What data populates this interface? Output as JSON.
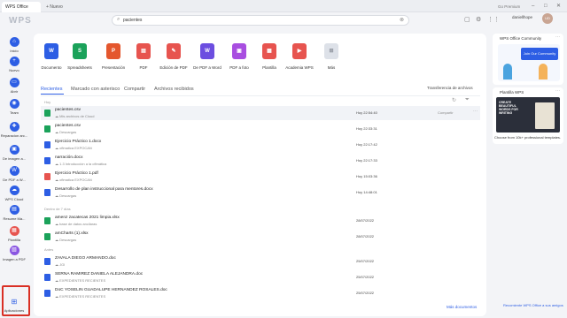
{
  "titlebar": {
    "app_tab": "WPS Office",
    "new_tab": "+  Nuevo",
    "premium": "Go Premium",
    "min": "–",
    "max": "□",
    "close": "✕"
  },
  "search": {
    "value": "pacientes",
    "icon": "search-icon"
  },
  "user": {
    "name": "daniellhope",
    "sub": "",
    "avatar": "UD"
  },
  "sidebar": {
    "items": [
      {
        "label": "Inicio",
        "color": "#2d5ee4",
        "glyph": "⌂"
      },
      {
        "label": "Nuevo",
        "color": "#2d5ee4",
        "glyph": "+"
      },
      {
        "label": "Abrir",
        "color": "#2d5ee4",
        "glyph": "▭"
      },
      {
        "label": "Team",
        "color": "#2d5ee4",
        "glyph": "◉"
      },
      {
        "label": "Reparacion arc...",
        "color": "#2d5ee4",
        "glyph": "✚"
      },
      {
        "label": "De imagen a...",
        "color": "#2d5ee4",
        "glyph": "▣"
      },
      {
        "label": "De PDF a W...",
        "color": "#2d5ee4",
        "glyph": "W"
      },
      {
        "label": "WPS Cloud",
        "color": "#2d5ee4",
        "glyph": "☁"
      },
      {
        "label": "Resume Ma...",
        "color": "#2d5ee4",
        "glyph": "▤"
      },
      {
        "label": "Plantilla",
        "color": "#e7544f",
        "glyph": "▦"
      },
      {
        "label": "Imagen a PDF",
        "color": "#8a56e2",
        "glyph": "▧"
      }
    ],
    "apps": {
      "label": "Aplicaciones",
      "glyph": "⊞"
    }
  },
  "newrow": [
    {
      "label": "Documento",
      "color": "#2d5ee4",
      "glyph": "W"
    },
    {
      "label": "Spreadsheets",
      "color": "#1ba25a",
      "glyph": "S"
    },
    {
      "label": "Presentación",
      "color": "#e4572e",
      "glyph": "P"
    },
    {
      "label": "PDF",
      "color": "#e7544f",
      "glyph": "▤"
    },
    {
      "label": "Edición de PDF",
      "color": "#e7544f",
      "glyph": "✎"
    },
    {
      "label": "De PDF a Word",
      "color": "#6c4ee0",
      "glyph": "W"
    },
    {
      "label": "PDF a foto",
      "color": "#a84ee0",
      "glyph": "▣"
    },
    {
      "label": "Plantilla",
      "color": "#e7544f",
      "glyph": "▦"
    },
    {
      "label": "Academia WPS",
      "color": "#e7544f",
      "glyph": "▶"
    },
    {
      "label": "Más",
      "color": "#dde1e8",
      "glyph": "⊞"
    }
  ],
  "tabs": {
    "recent": "Recientes",
    "starred": "Marcado con asterisco",
    "shared": "Compartir",
    "received": "Archivos recibidos"
  },
  "transfer": "Transferencia de archivos",
  "groups": {
    "today": "Hoy",
    "earlier": "Dentro de 7 días",
    "older": "Antes"
  },
  "files": [
    {
      "name": "pacientes.csv",
      "loc": "Mis archivos de Cloud",
      "date": "Hoy 22:54:40",
      "color": "#1ba25a",
      "share": "Compartir",
      "more": "···"
    },
    {
      "name": "pacientes.csv",
      "loc": "Descargas",
      "date": "Hoy 22:33:31",
      "color": "#1ba25a"
    },
    {
      "name": "Ejercicio Práctico 1.docx",
      "loc": "ofimatica EXPOCAN",
      "date": "Hoy 22:17:42",
      "color": "#2d5ee4"
    },
    {
      "name": "narración.docx",
      "loc": "1.3 Introducción a la ofimática",
      "date": "Hoy 22:17:33",
      "color": "#2d5ee4"
    },
    {
      "name": "Ejercicio Práctico 1.pdf",
      "loc": "ofimatica EXPOCAN",
      "date": "Hoy 15:03:36",
      "color": "#e7544f"
    },
    {
      "name": "Desarrollo de plan instruccional para mentores.docx",
      "loc": "Descargas",
      "date": "Hoy 14:48:01",
      "color": "#2d5ee4"
    },
    {
      "name": "amenz zacatecas 2021 limpia.xlsx",
      "loc": "base de datos ancilaras",
      "date": "28/07/2022",
      "color": "#1ba25a"
    },
    {
      "name": "amCharts (1).xlsx",
      "loc": "Descargas",
      "date": "28/07/2022",
      "color": "#1ba25a"
    },
    {
      "name": "ZAVALA DIEGO ARMANDO.doc",
      "loc": "JGI",
      "date": "25/07/2022",
      "color": "#2d5ee4"
    },
    {
      "name": "SERNA RAMIREZ DANIELA ALEJANDRA.doc",
      "loc": "EXPEDIENTES RECIENTES",
      "date": "25/07/2022",
      "color": "#2d5ee4"
    },
    {
      "name": "DoC YOSELIN GUADALUPE HERNANDEZ ROSALES.doc",
      "loc": "EXPEDIENTES RECIENTES",
      "date": "25/07/2022",
      "color": "#2d5ee4"
    }
  ],
  "right": {
    "community": {
      "title": "WPS Office Community",
      "cta": "Join Our Community",
      "more": "···"
    },
    "templates": {
      "title": "Plantilla WPS",
      "caption": "Choose from 10k+ professional templates.",
      "more": "···",
      "banner": "CREATE BEAUTIFUL WORDS FOR WRITING"
    }
  },
  "footer": {
    "more_docs": "Más documentos",
    "recommend": "Recomiente WPS Office a sus amigos"
  },
  "colors": {
    "accent": "#2d5ee4",
    "highlight": "#d93025"
  }
}
